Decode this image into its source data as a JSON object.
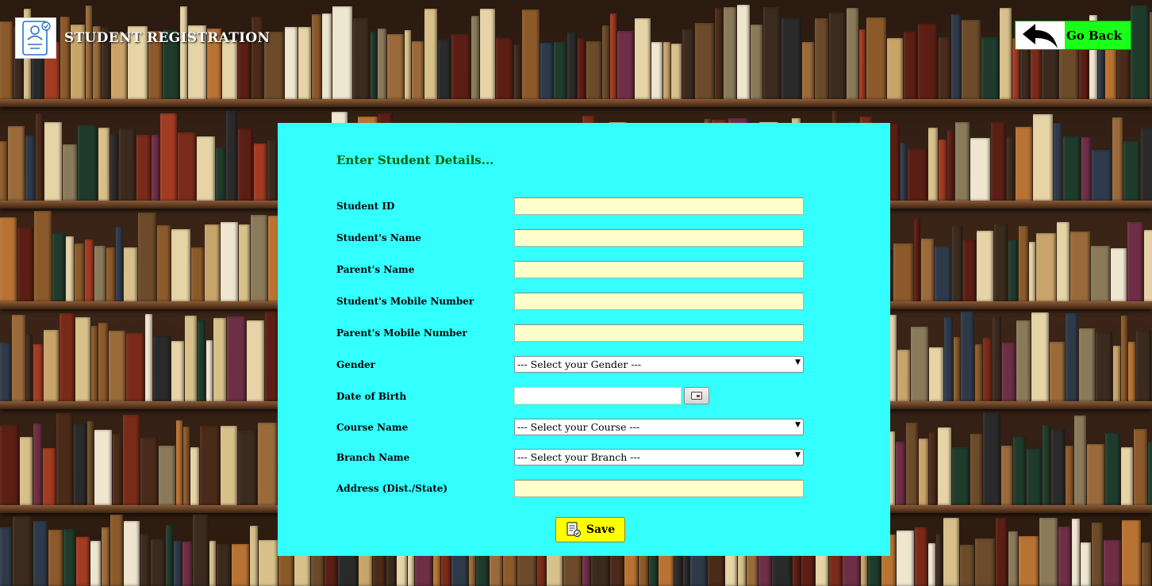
{
  "header": {
    "title": "STUDENT REGISTRATION",
    "go_back_label": "Go Back"
  },
  "form": {
    "heading": "Enter Student Details...",
    "fields": {
      "student_id": {
        "label": "Student ID",
        "value": ""
      },
      "student_name": {
        "label": "Student's Name",
        "value": ""
      },
      "parent_name": {
        "label": "Parent's Name",
        "value": ""
      },
      "student_mobile": {
        "label": "Student's Mobile Number",
        "value": ""
      },
      "parent_mobile": {
        "label": "Parent's Mobile Number",
        "value": ""
      },
      "gender": {
        "label": "Gender",
        "selected": "--- Select your Gender ---"
      },
      "dob": {
        "label": "Date of Birth",
        "value": ""
      },
      "course": {
        "label": "Course Name",
        "selected": "--- Select your Course ---"
      },
      "branch": {
        "label": "Branch Name",
        "selected": "--- Select your Branch ---"
      },
      "address": {
        "label": "Address (Dist./State)",
        "value": ""
      }
    },
    "save_label": "Save"
  },
  "colors": {
    "panel": "#33ffff",
    "input_bg": "#ffffcc",
    "heading": "#006400",
    "go_back_bg": "#1aff1a",
    "save_bg": "#ffff00"
  },
  "icons": [
    "student-form-logo-icon",
    "back-arrow-icon",
    "calendar-icon",
    "save-document-icon"
  ]
}
